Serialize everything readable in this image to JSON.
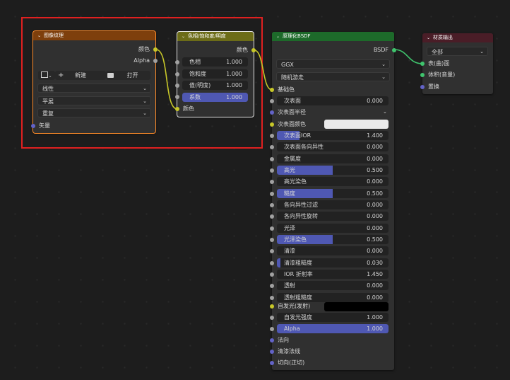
{
  "colors": {
    "wire_color": "#c7c729",
    "wire_shader": "#3fc46d",
    "sock_color": "#c7c729",
    "sock_float": "#a1a1a1",
    "sock_vector": "#6363c7",
    "sock_shader": "#3fc46d",
    "hdr_texture": "#7e3f0c",
    "hdr_color": "#6c6c18",
    "hdr_shader": "#1d6a2a",
    "hdr_output": "#4a1d27",
    "selection_box": "#e02020"
  },
  "image_texture": {
    "title": "图像纹理",
    "outputs": [
      "颜色",
      "Alpha"
    ],
    "new_label": "新建",
    "open_label": "打开",
    "interpolation": "线性",
    "projection": "平展",
    "extension": "重复",
    "input_vector": "矢量"
  },
  "hsv": {
    "title": "色相/饱和度/明度",
    "output": "颜色",
    "fields": [
      {
        "label": "色相",
        "value": "1.000"
      },
      {
        "label": "饱和度",
        "value": "1.000"
      },
      {
        "label": "值(明度)",
        "value": "1.000"
      },
      {
        "label": "系数",
        "value": "1.000",
        "fill": 1.0
      }
    ],
    "input_color": "颜色"
  },
  "bsdf": {
    "title": "原理化BSDF",
    "output": "BSDF",
    "distribution": "GGX",
    "subsurface_method": "随机游走",
    "base_color": "基础色",
    "subsurface": {
      "label": "次表面",
      "value": "0.000"
    },
    "subsurface_radius": "次表面半径",
    "subsurface_color": {
      "label": "次表面颜色",
      "swatch": "#eaeaea"
    },
    "params": [
      {
        "label": "次表面IOR",
        "value": "1.400",
        "fill": 0.2
      },
      {
        "label": "次表面各向异性",
        "value": "0.000"
      },
      {
        "label": "金属度",
        "value": "0.000"
      },
      {
        "label": "高光",
        "value": "0.500",
        "fill": 0.5
      },
      {
        "label": "高光染色",
        "value": "0.000"
      },
      {
        "label": "糙度",
        "value": "0.500",
        "fill": 0.5
      },
      {
        "label": "各向异性过滤",
        "value": "0.000"
      },
      {
        "label": "各向异性旋转",
        "value": "0.000"
      },
      {
        "label": "光泽",
        "value": "0.000"
      },
      {
        "label": "光泽染色",
        "value": "0.500",
        "fill": 0.5
      },
      {
        "label": "清漆",
        "value": "0.000"
      },
      {
        "label": "清漆粗糙度",
        "value": "0.030",
        "fill": 0.03
      },
      {
        "label": "IOR 折射率",
        "value": "1.450"
      },
      {
        "label": "透射",
        "value": "0.000"
      },
      {
        "label": "透射粗糙度",
        "value": "0.000"
      }
    ],
    "emission": {
      "label": "自发光(发射)",
      "swatch": "#000000"
    },
    "emission_strength": {
      "label": "自发光强度",
      "value": "1.000"
    },
    "alpha": {
      "label": "Alpha",
      "value": "1.000",
      "fill": 1.0
    },
    "vectors": [
      "法向",
      "清漆法线",
      "切向(正切)"
    ]
  },
  "output": {
    "title": "材质输出",
    "target": "全部",
    "inputs": [
      "表(曲)面",
      "体积(音量)",
      "置换"
    ]
  }
}
